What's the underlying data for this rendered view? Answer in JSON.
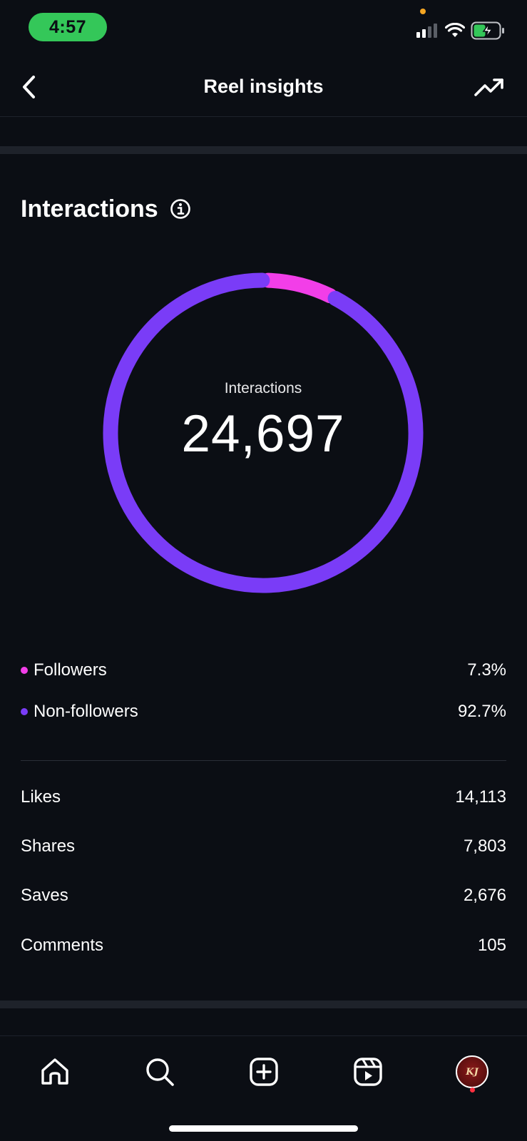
{
  "status_bar": {
    "time": "4:57"
  },
  "header": {
    "title": "Reel insights"
  },
  "section": {
    "title": "Interactions"
  },
  "donut": {
    "center_label": "Interactions",
    "center_value": "24,697"
  },
  "chart_data": {
    "type": "pie",
    "categories": [
      "Followers",
      "Non-followers"
    ],
    "values": [
      7.3,
      92.7
    ],
    "colors": [
      "#f23ee8",
      "#7a3cf7"
    ]
  },
  "legend": [
    {
      "label": "Followers",
      "value": "7.3%",
      "color": "#f23ee8"
    },
    {
      "label": "Non-followers",
      "value": "92.7%",
      "color": "#7a3cf7"
    }
  ],
  "metrics": [
    {
      "label": "Likes",
      "value": "14,113"
    },
    {
      "label": "Shares",
      "value": "7,803"
    },
    {
      "label": "Saves",
      "value": "2,676"
    },
    {
      "label": "Comments",
      "value": "105"
    }
  ],
  "bottom_nav": {
    "items": [
      "home-icon",
      "search-icon",
      "create-icon",
      "reels-icon",
      "profile-avatar"
    ],
    "avatar_text": "KJ"
  },
  "colors": {
    "background": "#0b0e14",
    "followers": "#f23ee8",
    "non_followers": "#7a3cf7",
    "status_green": "#34c759"
  }
}
